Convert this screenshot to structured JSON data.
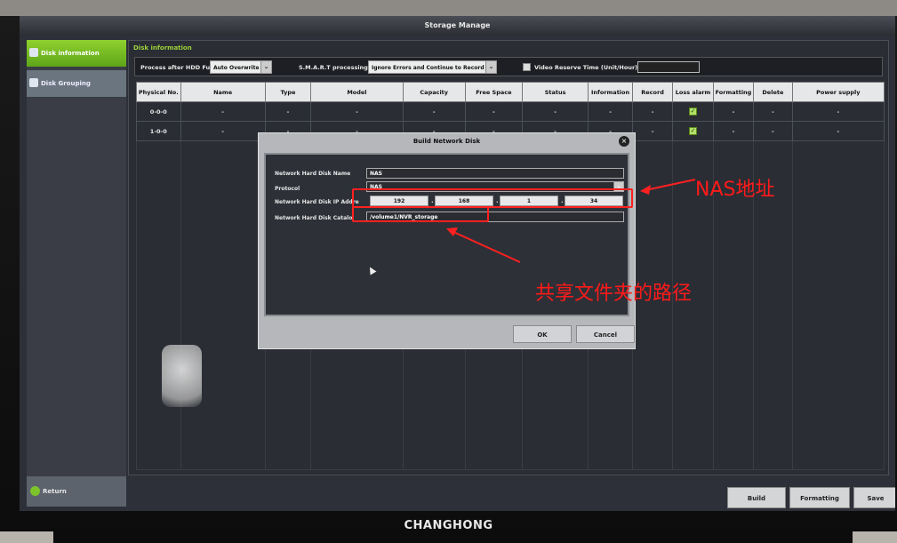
{
  "window": {
    "title": "Storage Manage"
  },
  "sidebar": {
    "items": [
      {
        "label": "Disk information"
      },
      {
        "label": "Disk Grouping"
      }
    ],
    "return_label": "Return"
  },
  "main": {
    "section": "Disk information",
    "options": {
      "process_label": "Process after HDD Full:",
      "process_value": "Auto Overwrite",
      "smart_label": "S.M.A.R.T processing:",
      "smart_value": "Ignore Errors and Continue to Record",
      "reserve_label": "Video Reserve Time (Unit/Hour):",
      "reserve_value": ""
    },
    "table": {
      "headers": [
        "Physical No.",
        "Name",
        "Type",
        "Model",
        "Capacity",
        "Free Space",
        "Status",
        "Information",
        "Record",
        "Loss alarm",
        "Formatting",
        "Delete",
        "Power supply"
      ],
      "rows": [
        [
          "0-0-0",
          "-",
          "-",
          "-",
          "-",
          "-",
          "-",
          "-",
          "-",
          "✓",
          "-",
          "-",
          "-"
        ],
        [
          "1-0-0",
          "-",
          "-",
          "-",
          "-",
          "-",
          "-",
          "-",
          "-",
          "✓",
          "-",
          "-",
          "-"
        ]
      ]
    },
    "buttons": {
      "build": "Build",
      "formatting": "Formatting",
      "save": "Save"
    }
  },
  "dialog": {
    "title": "Build Network Disk",
    "name_label": "Network Hard Disk Name",
    "name_value": "NAS",
    "protocol_label": "Protocol",
    "protocol_value": "NAS",
    "ip_label": "Network Hard Disk IP Addre",
    "ip": [
      "192",
      "168",
      "1",
      "34"
    ],
    "catalog_label": "Network Hard Disk Catalo",
    "catalog_value": "/volume1/NVR_storage",
    "ok": "OK",
    "cancel": "Cancel"
  },
  "annotations": {
    "nas_address": "NAS地址",
    "share_path": "共享文件夹的路径",
    "color": "#ff1a1a"
  },
  "brand": "CHANGHONG"
}
